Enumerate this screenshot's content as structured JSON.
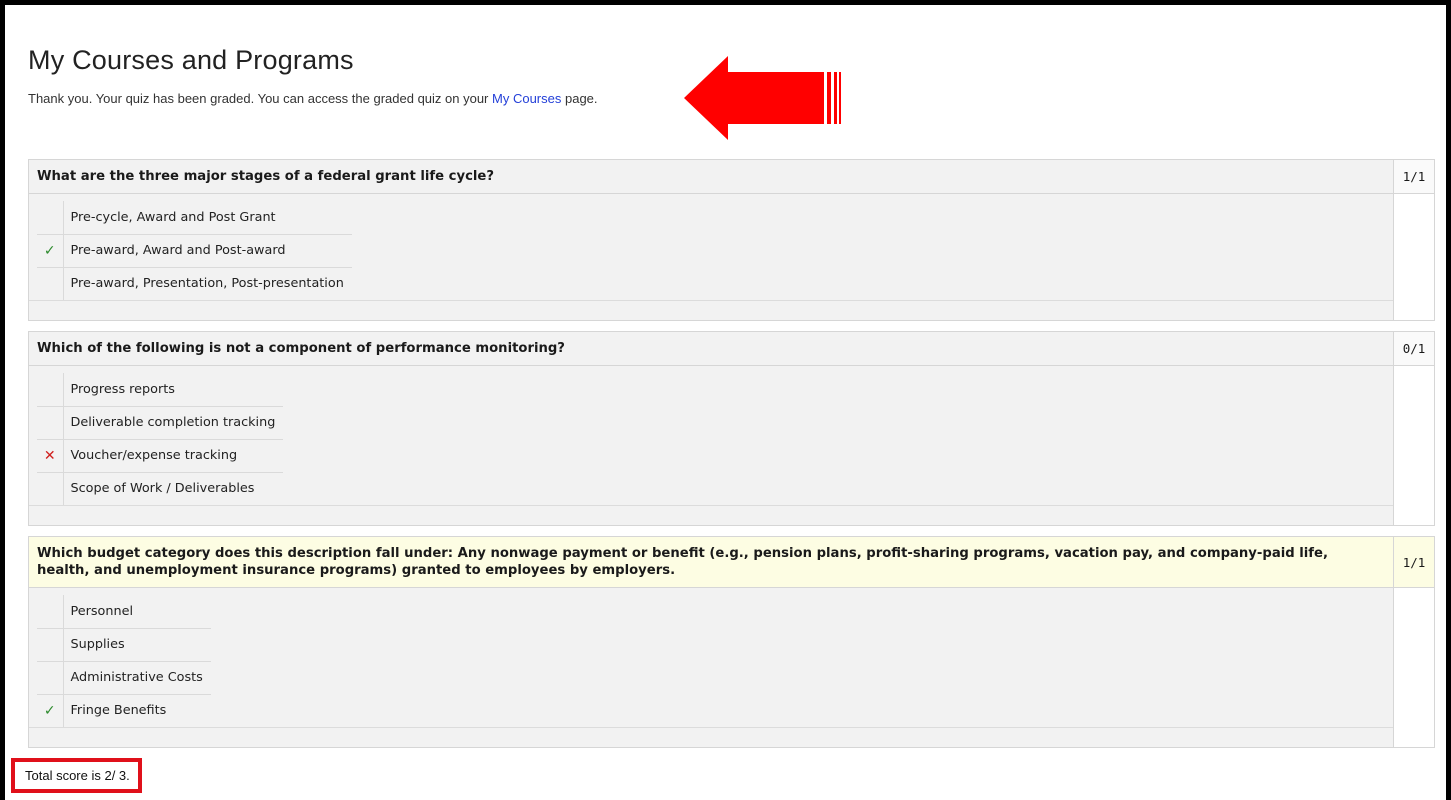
{
  "page": {
    "title": "My Courses and Programs",
    "notice_before": "Thank you. Your quiz has been graded. You can access the graded quiz on your ",
    "notice_link": "My Courses",
    "notice_after": " page."
  },
  "colors": {
    "arrow": "#ff0000",
    "link": "#2440d8",
    "correct_mark": "#2e8b2e",
    "wrong_mark": "#d0201e",
    "highlight_box": "#e0101a"
  },
  "questions": [
    {
      "text": "What are the three major stages of a federal grant life cycle?",
      "score": "1/1",
      "answers": [
        {
          "label": "Pre-cycle, Award and Post Grant",
          "mark": ""
        },
        {
          "label": "Pre-award, Award and Post-award",
          "mark": "✓"
        },
        {
          "label": "Pre-award, Presentation, Post-presentation",
          "mark": ""
        }
      ]
    },
    {
      "text": "Which of the following is not a component of performance monitoring?",
      "score": "0/1",
      "answers": [
        {
          "label": "Progress reports",
          "mark": ""
        },
        {
          "label": "Deliverable completion tracking",
          "mark": ""
        },
        {
          "label": "Voucher/expense tracking",
          "mark": "✕"
        },
        {
          "label": "Scope of Work / Deliverables",
          "mark": ""
        }
      ]
    },
    {
      "text": "Which budget category does this description fall under: Any nonwage payment or benefit (e.g., pension plans, profit-sharing programs, vacation pay, and company-paid life, health, and unemployment insurance programs) granted to employees by employers.",
      "score": "1/1",
      "answers": [
        {
          "label": "Personnel",
          "mark": ""
        },
        {
          "label": "Supplies",
          "mark": ""
        },
        {
          "label": "Administrative Costs",
          "mark": ""
        },
        {
          "label": "Fringe Benefits",
          "mark": "✓"
        }
      ]
    }
  ],
  "total": {
    "text": "Total score is 2/ 3."
  }
}
